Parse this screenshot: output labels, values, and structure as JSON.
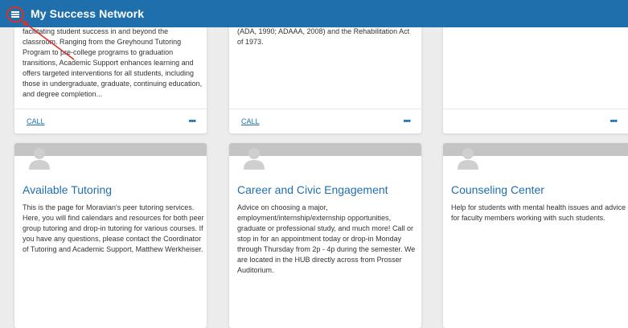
{
  "app": {
    "title": "My Success Network"
  },
  "icons": {
    "menu": "hamburger-menu-icon",
    "more": "more-dots-icon",
    "avatar": "person-avatar-icon"
  },
  "colors": {
    "header": "#1f6fad",
    "link": "#1f6fad",
    "highlight": "#d6312b",
    "banner": "#c4c4c4"
  },
  "top_cards": [
    {
      "description": "facilitating student success in and beyond the classroom. Ranging from the Greyhound Tutoring Program to pre-college programs to graduation transitions, Academic Support enhances learning and offers targeted interventions for all students, including those in undergraduate, graduate, continuing education, and degree completion...",
      "call_label": "CALL",
      "more_label": "•••"
    },
    {
      "description": "(ADA, 1990; ADAAA, 2008) and the Rehabilitation Act of 1973.",
      "call_label": "CALL",
      "more_label": "•••"
    },
    {
      "description": "",
      "more_label": "•••"
    }
  ],
  "cards": [
    {
      "title": "Available Tutoring",
      "description": "This is the page for Moravian's peer tutoring services. Here, you will find calendars and resources for both peer group tutoring and drop-in tutoring for various courses. If you have any questions, please contact the Coordinator of Tutoring and Academic Support, Matthew Werkheiser."
    },
    {
      "title": "Career and Civic Engagement",
      "description": "Advice on choosing a major, employment/internship/externship opportunities, graduate or professional study, and much more! Call or stop in for an appointment today or drop-in Monday through Thursday from 2p - 4p during the semester. We are located in the HUB directly across from Prosser Auditorium."
    },
    {
      "title": "Counseling Center",
      "description": "Help for students with mental health issues and advice for faculty members working with such students."
    }
  ]
}
